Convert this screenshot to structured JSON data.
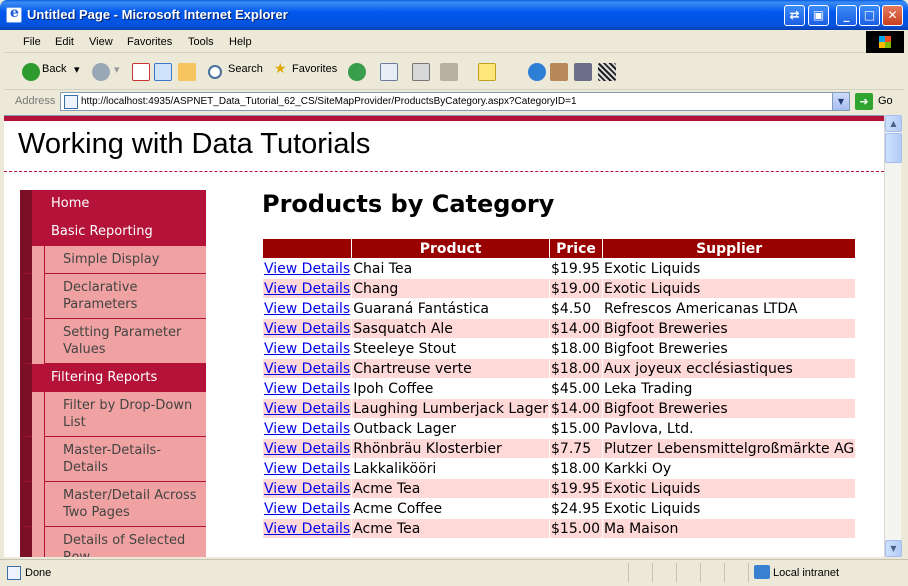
{
  "window": {
    "title": "Untitled Page - Microsoft Internet Explorer"
  },
  "menu": [
    "File",
    "Edit",
    "View",
    "Favorites",
    "Tools",
    "Help"
  ],
  "toolbar": {
    "back": "Back",
    "search": "Search",
    "favorites": "Favorites"
  },
  "address": {
    "label": "Address",
    "url": "http://localhost:4935/ASPNET_Data_Tutorial_62_CS/SiteMapProvider/ProductsByCategory.aspx?CategoryID=1",
    "go": "Go"
  },
  "site": {
    "header": "Working with Data Tutorials"
  },
  "sidebar": [
    {
      "label": "Home",
      "level": "top"
    },
    {
      "label": "Basic Reporting",
      "level": "top"
    },
    {
      "label": "Simple Display",
      "level": "sub"
    },
    {
      "label": "Declarative Parameters",
      "level": "sub"
    },
    {
      "label": "Setting Parameter Values",
      "level": "sub"
    },
    {
      "label": "Filtering Reports",
      "level": "top"
    },
    {
      "label": "Filter by Drop-Down List",
      "level": "sub"
    },
    {
      "label": "Master-Details-Details",
      "level": "sub"
    },
    {
      "label": "Master/Detail Across Two Pages",
      "level": "sub"
    },
    {
      "label": "Details of Selected Row",
      "level": "sub"
    }
  ],
  "page": {
    "title": "Products by Category",
    "columns": [
      "",
      "Product",
      "Price",
      "Supplier"
    ],
    "link_label": "View Details",
    "rows": [
      {
        "product": "Chai Tea",
        "price": "$19.95",
        "supplier": "Exotic Liquids"
      },
      {
        "product": "Chang",
        "price": "$19.00",
        "supplier": "Exotic Liquids"
      },
      {
        "product": "Guaraná Fantástica",
        "price": "$4.50",
        "supplier": "Refrescos Americanas LTDA"
      },
      {
        "product": "Sasquatch Ale",
        "price": "$14.00",
        "supplier": "Bigfoot Breweries"
      },
      {
        "product": "Steeleye Stout",
        "price": "$18.00",
        "supplier": "Bigfoot Breweries"
      },
      {
        "product": "Chartreuse verte",
        "price": "$18.00",
        "supplier": "Aux joyeux ecclésiastiques"
      },
      {
        "product": "Ipoh Coffee",
        "price": "$45.00",
        "supplier": "Leka Trading"
      },
      {
        "product": "Laughing Lumberjack Lager",
        "price": "$14.00",
        "supplier": "Bigfoot Breweries"
      },
      {
        "product": "Outback Lager",
        "price": "$15.00",
        "supplier": "Pavlova, Ltd."
      },
      {
        "product": "Rhönbräu Klosterbier",
        "price": "$7.75",
        "supplier": "Plutzer Lebensmittelgroßmärkte AG"
      },
      {
        "product": "Lakkalikööri",
        "price": "$18.00",
        "supplier": "Karkki Oy"
      },
      {
        "product": "Acme Tea",
        "price": "$19.95",
        "supplier": "Exotic Liquids"
      },
      {
        "product": "Acme Coffee",
        "price": "$24.95",
        "supplier": "Exotic Liquids"
      },
      {
        "product": "Acme Tea",
        "price": "$15.00",
        "supplier": "Ma Maison"
      }
    ]
  },
  "status": {
    "text": "Done",
    "zone": "Local intranet"
  },
  "colors": {
    "accent": "#B5123A",
    "header_bg": "#990000",
    "alt_row": "#FFD8D8",
    "nav_sub": "#F0A1A1"
  }
}
